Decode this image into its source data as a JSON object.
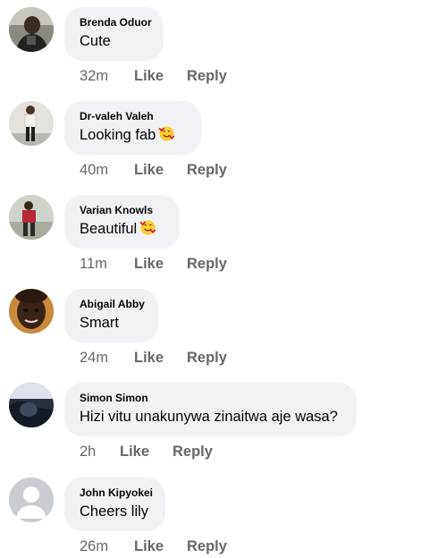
{
  "actions": {
    "like_label": "Like",
    "reply_label": "Reply"
  },
  "comments": [
    {
      "author": "Brenda Oduor",
      "text": "Cute",
      "emoji": "",
      "time": "32m",
      "avatar_icon": "user-photo"
    },
    {
      "author": "Dr-valeh Valeh",
      "text": "Looking fab",
      "emoji": "smiling-face-with-hearts",
      "time": "40m",
      "avatar_icon": "user-photo"
    },
    {
      "author": "Varian Knowls",
      "text": "Beautiful",
      "emoji": "smiling-face-with-hearts",
      "time": "11m",
      "avatar_icon": "user-photo"
    },
    {
      "author": "Abigail Abby",
      "text": "Smart",
      "emoji": "",
      "time": "24m",
      "avatar_icon": "user-photo"
    },
    {
      "author": "Simon Simon",
      "text": "Hizi vitu unakunywa zinaitwa aje wasa?",
      "emoji": "",
      "time": "2h",
      "avatar_icon": "user-photo"
    },
    {
      "author": "John Kipyokei",
      "text": "Cheers lily",
      "emoji": "",
      "time": "26m",
      "avatar_icon": "default-avatar"
    }
  ]
}
